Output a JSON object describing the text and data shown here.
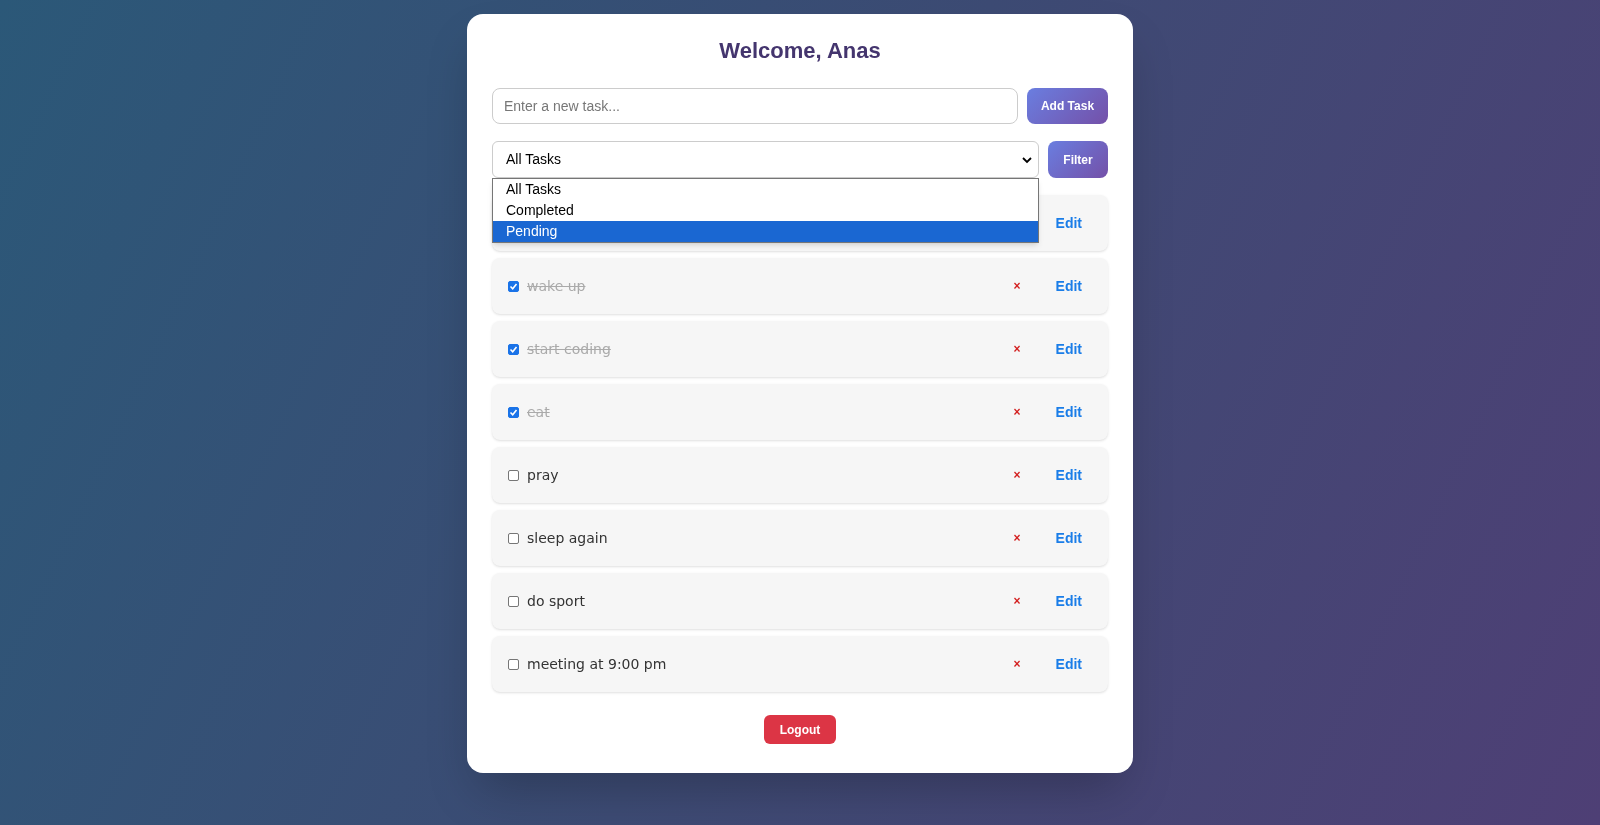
{
  "title": "Welcome, Anas",
  "new_task": {
    "placeholder": "Enter a new task..."
  },
  "add_button": "Add Task",
  "filter_select": {
    "value": "All Tasks"
  },
  "filter_button": "Filter",
  "dropdown_options": [
    {
      "label": "All Tasks",
      "selected": false
    },
    {
      "label": "Completed",
      "selected": false
    },
    {
      "label": "Pending",
      "selected": true
    }
  ],
  "tasks": [
    {
      "edit": "Edit"
    },
    {
      "text": "wake up",
      "checked": true,
      "delete": "×",
      "edit": "Edit"
    },
    {
      "text": "start coding",
      "checked": true,
      "delete": "×",
      "edit": "Edit"
    },
    {
      "text": "eat",
      "checked": true,
      "delete": "×",
      "edit": "Edit"
    },
    {
      "text": "pray",
      "checked": false,
      "delete": "×",
      "edit": "Edit"
    },
    {
      "text": "sleep again",
      "checked": false,
      "delete": "×",
      "edit": "Edit"
    },
    {
      "text": "do sport",
      "checked": false,
      "delete": "×",
      "edit": "Edit"
    },
    {
      "text": "meeting at 9:00 pm",
      "checked": false,
      "delete": "×",
      "edit": "Edit"
    }
  ],
  "logout_button": "Logout"
}
